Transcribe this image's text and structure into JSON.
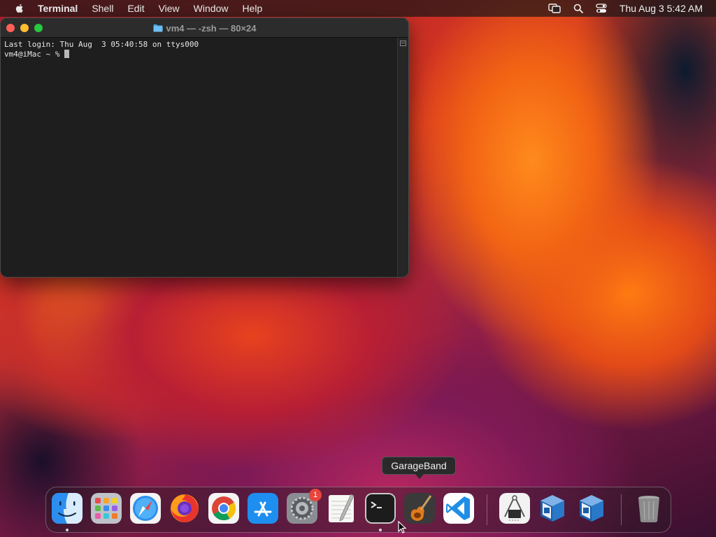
{
  "menubar": {
    "app_name": "Terminal",
    "menus": [
      "Shell",
      "Edit",
      "View",
      "Window",
      "Help"
    ],
    "status_icons": [
      "screen-mirroring-icon",
      "search-icon",
      "control-center-icon"
    ],
    "clock": "Thu Aug 3  5:42 AM"
  },
  "terminal": {
    "title": "vm4 — -zsh — 80×24",
    "lines": [
      "Last login: Thu Aug  3 05:40:58 on ttys000",
      "vm4@iMac ~ % "
    ]
  },
  "tooltip": {
    "text": "GarageBand"
  },
  "dock": {
    "apps": [
      {
        "name": "Finder",
        "icon": "finder-icon",
        "running": true
      },
      {
        "name": "Launchpad",
        "icon": "launchpad-icon",
        "running": false
      },
      {
        "name": "Safari",
        "icon": "safari-icon",
        "running": false
      },
      {
        "name": "Firefox",
        "icon": "firefox-icon",
        "running": false
      },
      {
        "name": "Google Chrome",
        "icon": "chrome-icon",
        "running": false
      },
      {
        "name": "App Store",
        "icon": "app-store-icon",
        "running": false
      },
      {
        "name": "System Settings",
        "icon": "system-settings-icon",
        "running": false,
        "badge": "1"
      },
      {
        "name": "TextEdit",
        "icon": "textedit-icon",
        "running": false
      },
      {
        "name": "Terminal",
        "icon": "terminal-icon",
        "running": true
      },
      {
        "name": "GarageBand",
        "icon": "garageband-icon",
        "running": false
      },
      {
        "name": "Visual Studio Code",
        "icon": "vscode-icon",
        "running": false
      },
      {
        "name": "System Information",
        "icon": "system-information-icon",
        "running": false
      },
      {
        "name": "VirtualBox",
        "icon": "virtualbox-icon",
        "running": false
      },
      {
        "name": "VirtualBox",
        "icon": "virtualbox-icon",
        "running": false
      },
      {
        "name": "Trash",
        "icon": "trash-icon",
        "running": false
      }
    ]
  },
  "colors": {
    "close": "#fe5f57",
    "minimize": "#febc2e",
    "maximize": "#28c840",
    "badge": "#e8453c",
    "terminal_bg": "#1e1e1e"
  }
}
